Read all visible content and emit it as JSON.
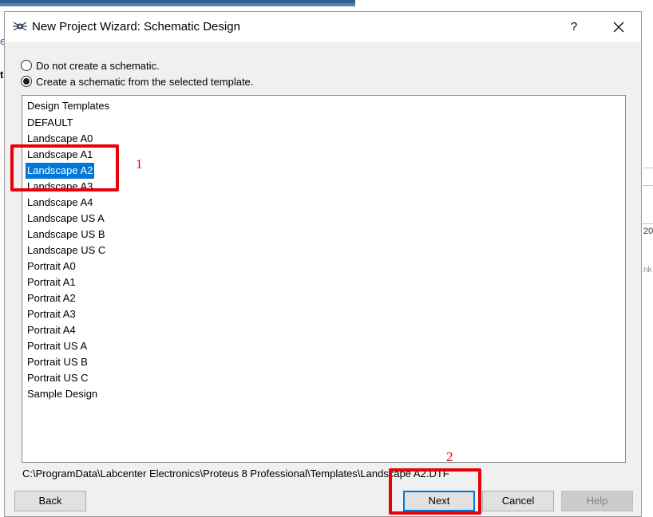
{
  "dialog": {
    "title": "New Project Wizard: Schematic Design",
    "help_label": "?",
    "options": [
      {
        "label": "Do not create a schematic.",
        "checked": false
      },
      {
        "label": "Create a schematic from the selected template.",
        "checked": true
      }
    ],
    "templates": {
      "header": "Design Templates",
      "items": [
        "DEFAULT",
        "Landscape A0",
        "Landscape A1",
        "Landscape A2",
        "Landscape A3",
        "Landscape A4",
        "Landscape US A",
        "Landscape US B",
        "Landscape US C",
        "Portrait A0",
        "Portrait A1",
        "Portrait A2",
        "Portrait A3",
        "Portrait A4",
        "Portrait US A",
        "Portrait US B",
        "Portrait US C",
        "Sample Design"
      ],
      "selected": "Landscape A2"
    },
    "template_path": "C:\\ProgramData\\Labcenter Electronics\\Proteus 8 Professional\\Templates\\Landscape A2.DTF",
    "buttons": {
      "back": "Back",
      "next": "Next",
      "cancel": "Cancel",
      "help": "Help"
    }
  },
  "annotations": {
    "step1": "1",
    "step2": "2"
  },
  "background": {
    "right_number": "20",
    "right_faded_text": "nk"
  },
  "colors": {
    "selection": "#0078d7",
    "annotation": "#e8000b"
  }
}
